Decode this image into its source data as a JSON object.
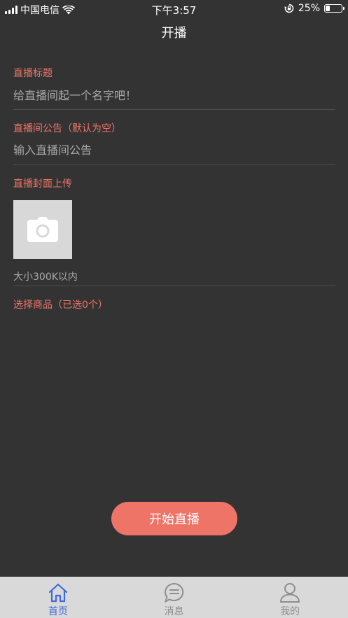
{
  "status_bar": {
    "carrier": "中国电信",
    "time": "下午3:57",
    "battery_text": "25%",
    "battery_level": 0.25
  },
  "nav": {
    "title": "开播"
  },
  "form": {
    "title_label": "直播标题",
    "title_placeholder": "给直播间起一个名字吧！",
    "notice_label": "直播间公告（默认为空）",
    "notice_placeholder": "输入直播间公告",
    "cover_label": "直播封面上传",
    "cover_icon": "camera-icon",
    "size_hint": "大小300K以内",
    "goods_label": "选择商品（已选0个）"
  },
  "start_button": {
    "label": "开始直播"
  },
  "tab_bar": {
    "items": [
      {
        "label": "首页",
        "icon": "home-icon",
        "active": true
      },
      {
        "label": "消息",
        "icon": "message-icon",
        "active": false
      },
      {
        "label": "我的",
        "icon": "user-icon",
        "active": false
      }
    ]
  },
  "colors": {
    "background": "#333333",
    "accent": "#ee7468",
    "tab_active": "#3f6bd8",
    "tab_inactive": "#8e8e8e",
    "tab_bar_bg": "#d9d9d9"
  }
}
